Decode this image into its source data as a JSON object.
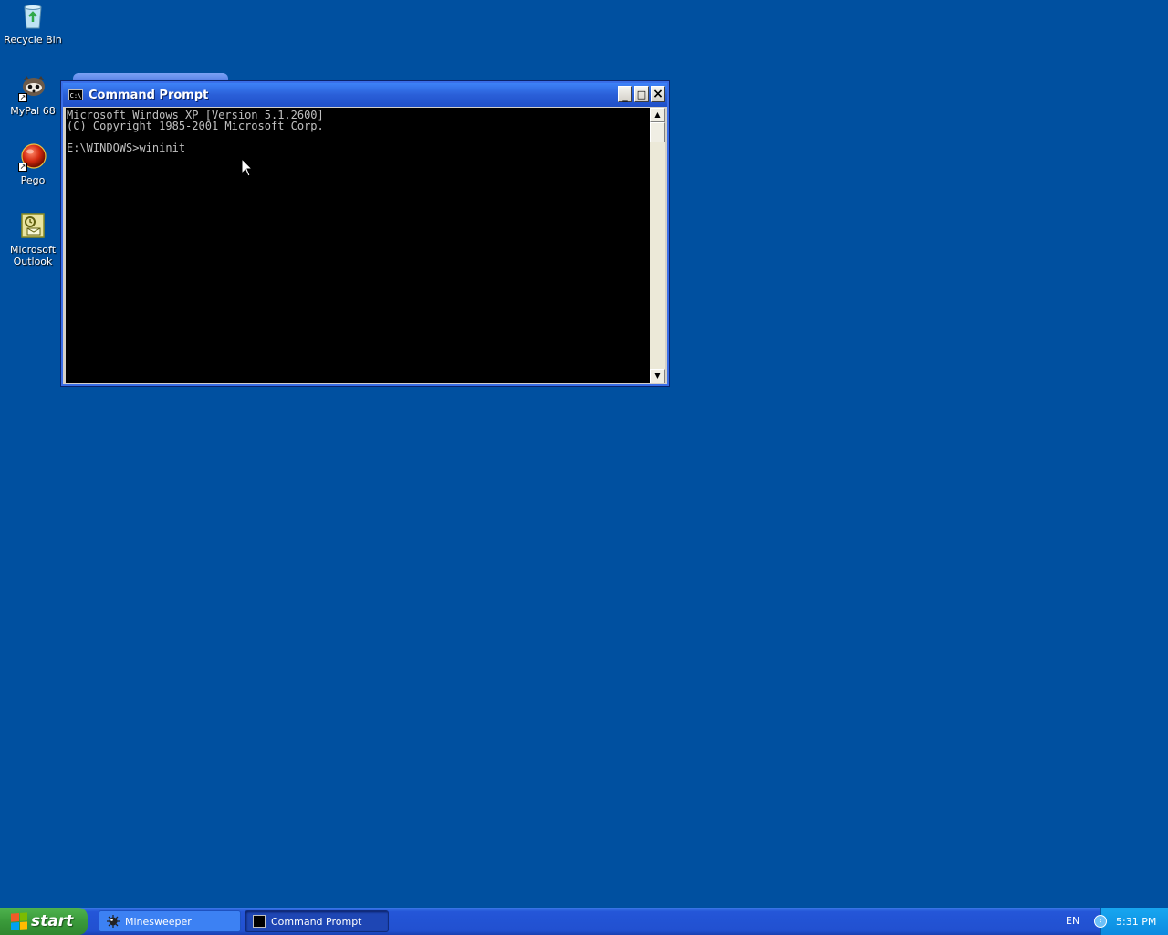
{
  "desktop": {
    "icons": [
      {
        "label": "Recycle Bin",
        "icon": "recycle-bin-icon"
      },
      {
        "label": "MyPal 68",
        "icon": "mypal-icon"
      },
      {
        "label": "Pego",
        "icon": "pego-icon"
      },
      {
        "label": "Microsoft\nOutlook",
        "icon": "outlook-icon"
      }
    ]
  },
  "cmd_window": {
    "title": "Command Prompt",
    "icon_text": "C:\\",
    "minimize": "_",
    "maximize": "□",
    "close": "×",
    "lines": "Microsoft Windows XP [Version 5.1.2600]\n(C) Copyright 1985-2001 Microsoft Corp.\n\nE:\\WINDOWS>wininit"
  },
  "taskbar": {
    "start_label": "start",
    "tasks": [
      {
        "label": "Minesweeper",
        "icon": "minesweeper-icon",
        "active": false
      },
      {
        "label": "Command Prompt",
        "icon": "cmd-icon",
        "active": true
      }
    ],
    "language": "EN",
    "clock": "5:31 PM"
  },
  "colors": {
    "desktop": "#0050a0",
    "titlebar": "#2a5fd8",
    "console_bg": "#000000",
    "console_fg": "#c0c0c0",
    "start_green": "#3a9a3a",
    "tray": "#0b8ae0"
  }
}
